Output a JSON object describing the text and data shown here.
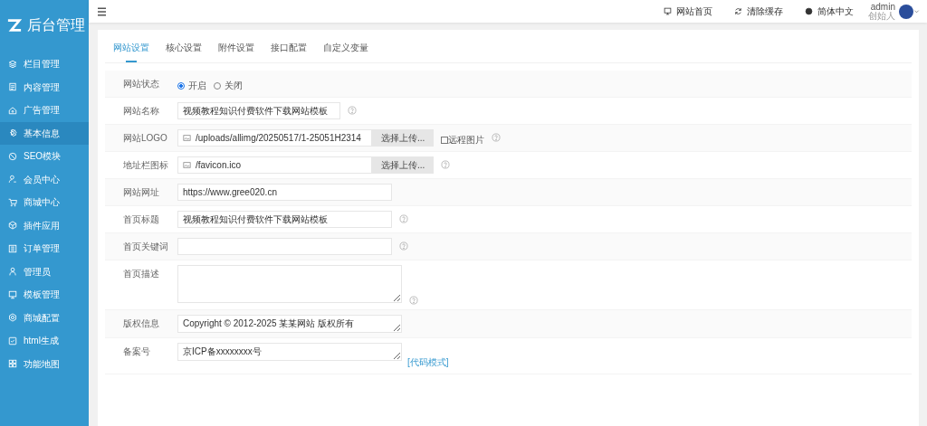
{
  "sidebar": {
    "logo": "后台管理",
    "items": [
      {
        "label": "栏目管理",
        "selected": false
      },
      {
        "label": "内容管理",
        "selected": false
      },
      {
        "label": "广告管理",
        "selected": false
      },
      {
        "label": "基本信息",
        "selected": true
      },
      {
        "label": "SEO模块",
        "selected": false
      },
      {
        "label": "会员中心",
        "selected": false
      },
      {
        "label": "商城中心",
        "selected": false
      },
      {
        "label": "插件应用",
        "selected": false
      },
      {
        "label": "订单管理",
        "selected": false
      },
      {
        "label": "管理员",
        "selected": false
      },
      {
        "label": "模板管理",
        "selected": false
      },
      {
        "label": "商城配置",
        "selected": false
      },
      {
        "label": "html生成",
        "selected": false
      },
      {
        "label": "功能地图",
        "selected": false
      }
    ]
  },
  "topbar": {
    "links": [
      "网站首页",
      "清除缓存",
      "简体中文"
    ],
    "user": {
      "name": "admin",
      "role": "创始人"
    }
  },
  "tabs": [
    {
      "label": "网站设置",
      "selected": true
    },
    {
      "label": "核心设置",
      "selected": false
    },
    {
      "label": "附件设置",
      "selected": false
    },
    {
      "label": "接口配置",
      "selected": false
    },
    {
      "label": "自定义变量",
      "selected": false
    }
  ],
  "form": [
    {
      "kind": "radio",
      "label": "网站状态",
      "options": [
        {
          "label": "开启",
          "selected": true
        },
        {
          "label": "关闭",
          "selected": false
        }
      ]
    },
    {
      "kind": "short_text",
      "label": "网站名称",
      "value": "视频教程知识付费软件下载网站模板",
      "help": true
    },
    {
      "kind": "file",
      "label": "网站LOGO",
      "value": "/uploads/allimg/20250517/1-25051H2314",
      "button": "选择上传...",
      "checkbox": {
        "label": "远程图片",
        "checked": false
      },
      "help": true
    },
    {
      "kind": "file",
      "label": "地址栏图标",
      "value": "/favicon.ico",
      "button": "选择上传...",
      "help": true
    },
    {
      "kind": "text",
      "label": "网站网址",
      "value": "https://www.gree020.cn",
      "help": false
    },
    {
      "kind": "text",
      "label": "首页标题",
      "value": "视频教程知识付费软件下载网站模板",
      "help": true
    },
    {
      "kind": "text",
      "label": "首页关键词",
      "help": true
    },
    {
      "kind": "memo",
      "label": "首页描述",
      "help": true
    },
    {
      "kind": "textarea",
      "label": "版权信息",
      "value": "Copyright © 2012-2025 某某网站 版权所有",
      "help": false
    },
    {
      "kind": "textarea",
      "label": "备案号",
      "value": "京ICP备xxxxxxxx号",
      "help": false,
      "link": "[代码模式]"
    }
  ]
}
